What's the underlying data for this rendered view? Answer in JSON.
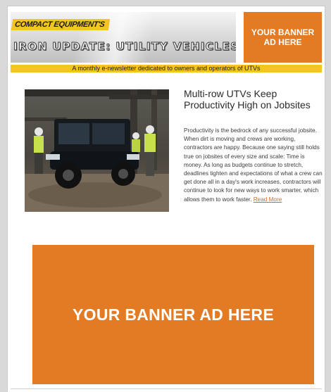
{
  "header": {
    "brand_tag": "COMPACT EQUIPMENT'S",
    "brand_title": "IRON UPDATE: UTILITY VEHICLES",
    "ad_small_label": "YOUR BANNER AD HERE"
  },
  "tagline": "A monthly e-newsletter dedicated to owners and operators of UTVs",
  "article": {
    "title": "Multi-row UTVs Keep Productivity High on Jobsites",
    "body": "Productivity is the bedrock of any successful jobsite. When dirt is moving and crews are working, contractors are happy. Because one saying still holds true on jobsites of every size and scale: Time is money. As long as budgets continue to stretch, deadlines tighten and expectations of what a crew can get done all in a day's work increases, contractors will continue to look for new ways to work smarter, which allows them to work faster.",
    "read_more": "Read More"
  },
  "ad_big_label": "YOUR BANNER AD HERE",
  "colors": {
    "accent_orange": "#e37b24",
    "accent_yellow": "#f4c51d",
    "link": "#c8721e"
  }
}
